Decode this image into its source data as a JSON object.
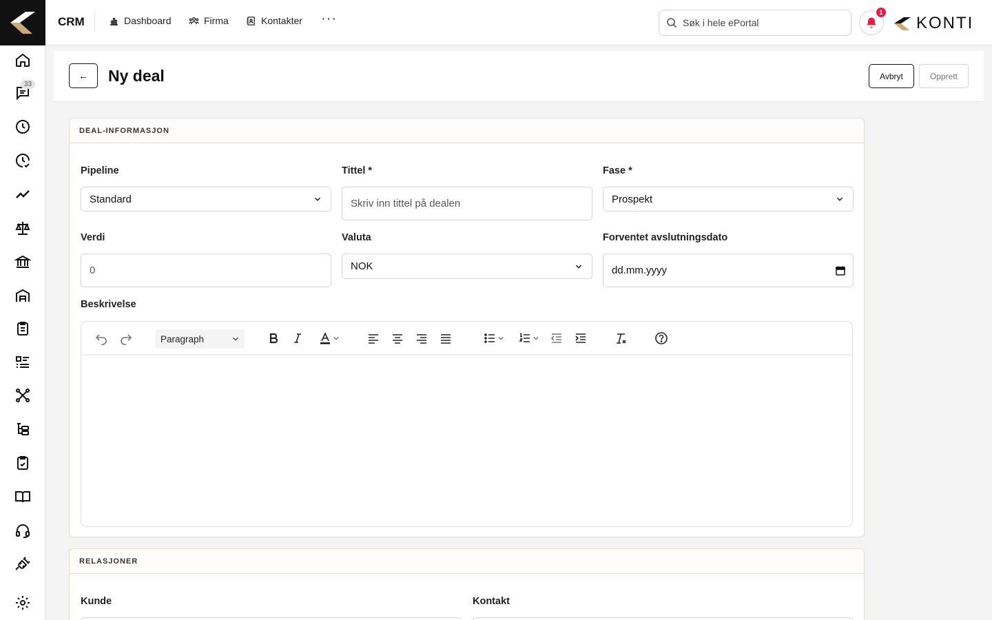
{
  "topbar": {
    "brand": "CRM",
    "nav": [
      {
        "label": "Dashboard",
        "icon": "chart-icon"
      },
      {
        "label": "Firma",
        "icon": "users-icon"
      },
      {
        "label": "Kontakter",
        "icon": "contact-book-icon"
      }
    ],
    "more": "···",
    "search_placeholder": "Søk i hele ePortal",
    "notification_count": "1",
    "logo_text": "KONTI"
  },
  "sidebar": {
    "chat_badge": "33",
    "items": [
      "home-icon",
      "chat-icon",
      "clock-icon",
      "clock-check-icon",
      "trend-icon",
      "scale-icon",
      "bank-icon",
      "warehouse-icon",
      "clipboard-icon",
      "list-icon",
      "network-icon",
      "tree-icon",
      "clipboard-check-icon",
      "book-icon",
      "headset-icon",
      "plug-icon",
      "settings-icon"
    ]
  },
  "header": {
    "back": "←",
    "title": "Ny deal",
    "cancel": "Avbryt",
    "create": "Opprett"
  },
  "deal_info": {
    "section_title": "DEAL-INFORMASJON",
    "pipeline_label": "Pipeline",
    "pipeline_value": "Standard",
    "title_label": "Tittel *",
    "title_placeholder": "Skriv inn tittel på dealen",
    "phase_label": "Fase *",
    "phase_value": "Prospekt",
    "value_label": "Verdi",
    "value_value": "0",
    "currency_label": "Valuta",
    "currency_value": "NOK",
    "close_date_label": "Forventet avslutningsdato",
    "close_date_placeholder": "dd.mm.yyyy",
    "description_label": "Beskrivelse",
    "editor_block": "Paragraph"
  },
  "relations": {
    "section_title": "RELASJONER",
    "customer_label": "Kunde",
    "contact_label": "Kontakt"
  },
  "colors": {
    "accent": "#e11d48",
    "text": "#111111",
    "border": "#d4d4d8"
  }
}
